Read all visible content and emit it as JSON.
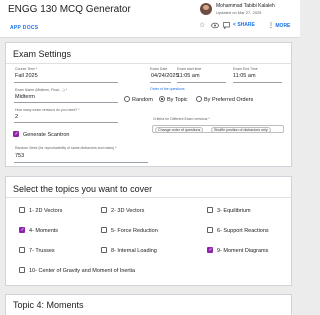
{
  "header": {
    "title": "ENGG 130 MCQ Generator",
    "app_docs": "APP DOCS",
    "author": "Mohammad Tabibi Kalaleh",
    "updated": "Updated on Mar 27, 2025",
    "share": "SHARE",
    "more": "MORE",
    "icons": [
      "star-icon",
      "eye-icon",
      "comment-icon",
      "share-icon",
      "more-vert-icon"
    ]
  },
  "exam_settings": {
    "title": "Exam Settings",
    "course_term": {
      "label": "Course Term *",
      "value": "Fall 2025"
    },
    "exam_date": {
      "label": "Exam Date",
      "value": "04/24/2025"
    },
    "exam_start": {
      "label": "Exam start time",
      "value": "11:05 am"
    },
    "exam_end": {
      "label": "Exam End Time",
      "value": "11:05 am"
    },
    "exam_name": {
      "label": "Exam Name (Midterm, Final, ...) *",
      "value": "Midterm"
    },
    "order_label": "Order of the questions",
    "order_options": [
      "Random",
      "By Topic",
      "By Preferred Orders"
    ],
    "order_selected": "By Topic",
    "num_versions": {
      "label": "How many exam versions do you need? *",
      "value": "2"
    },
    "criteria_label": "Criteria for Different Exam versions *",
    "criteria_chips": [
      "Change order of questions",
      "Shuffle position of distractors only"
    ],
    "scantron": {
      "label": "Generate Scantron",
      "checked": true
    },
    "random_seed": {
      "label": "Random Seed (for reproducibility of same distractors and ratios) *",
      "value": "753"
    }
  },
  "topics_section": {
    "title": "Select the topics you want to cover",
    "topics": [
      {
        "label": "1- 2D Vectors",
        "checked": false
      },
      {
        "label": "2- 3D Vectors",
        "checked": false
      },
      {
        "label": "3- Equilibrium",
        "checked": false
      },
      {
        "label": "4- Moments",
        "checked": true
      },
      {
        "label": "5- Force Reduction",
        "checked": false
      },
      {
        "label": "6- Support Reactions",
        "checked": false
      },
      {
        "label": "7- Trusses",
        "checked": false
      },
      {
        "label": "8- Internal Loading",
        "checked": false
      },
      {
        "label": "9- Moment Diagrams",
        "checked": true
      },
      {
        "label": "10- Center of Gravity and Moment of Inertia",
        "checked": false
      }
    ]
  },
  "topic4_section": {
    "title": "Topic 4: Moments"
  },
  "colors": {
    "accent": "#1a73e8",
    "checkbox": "#8e24aa",
    "background": "#ececec"
  }
}
